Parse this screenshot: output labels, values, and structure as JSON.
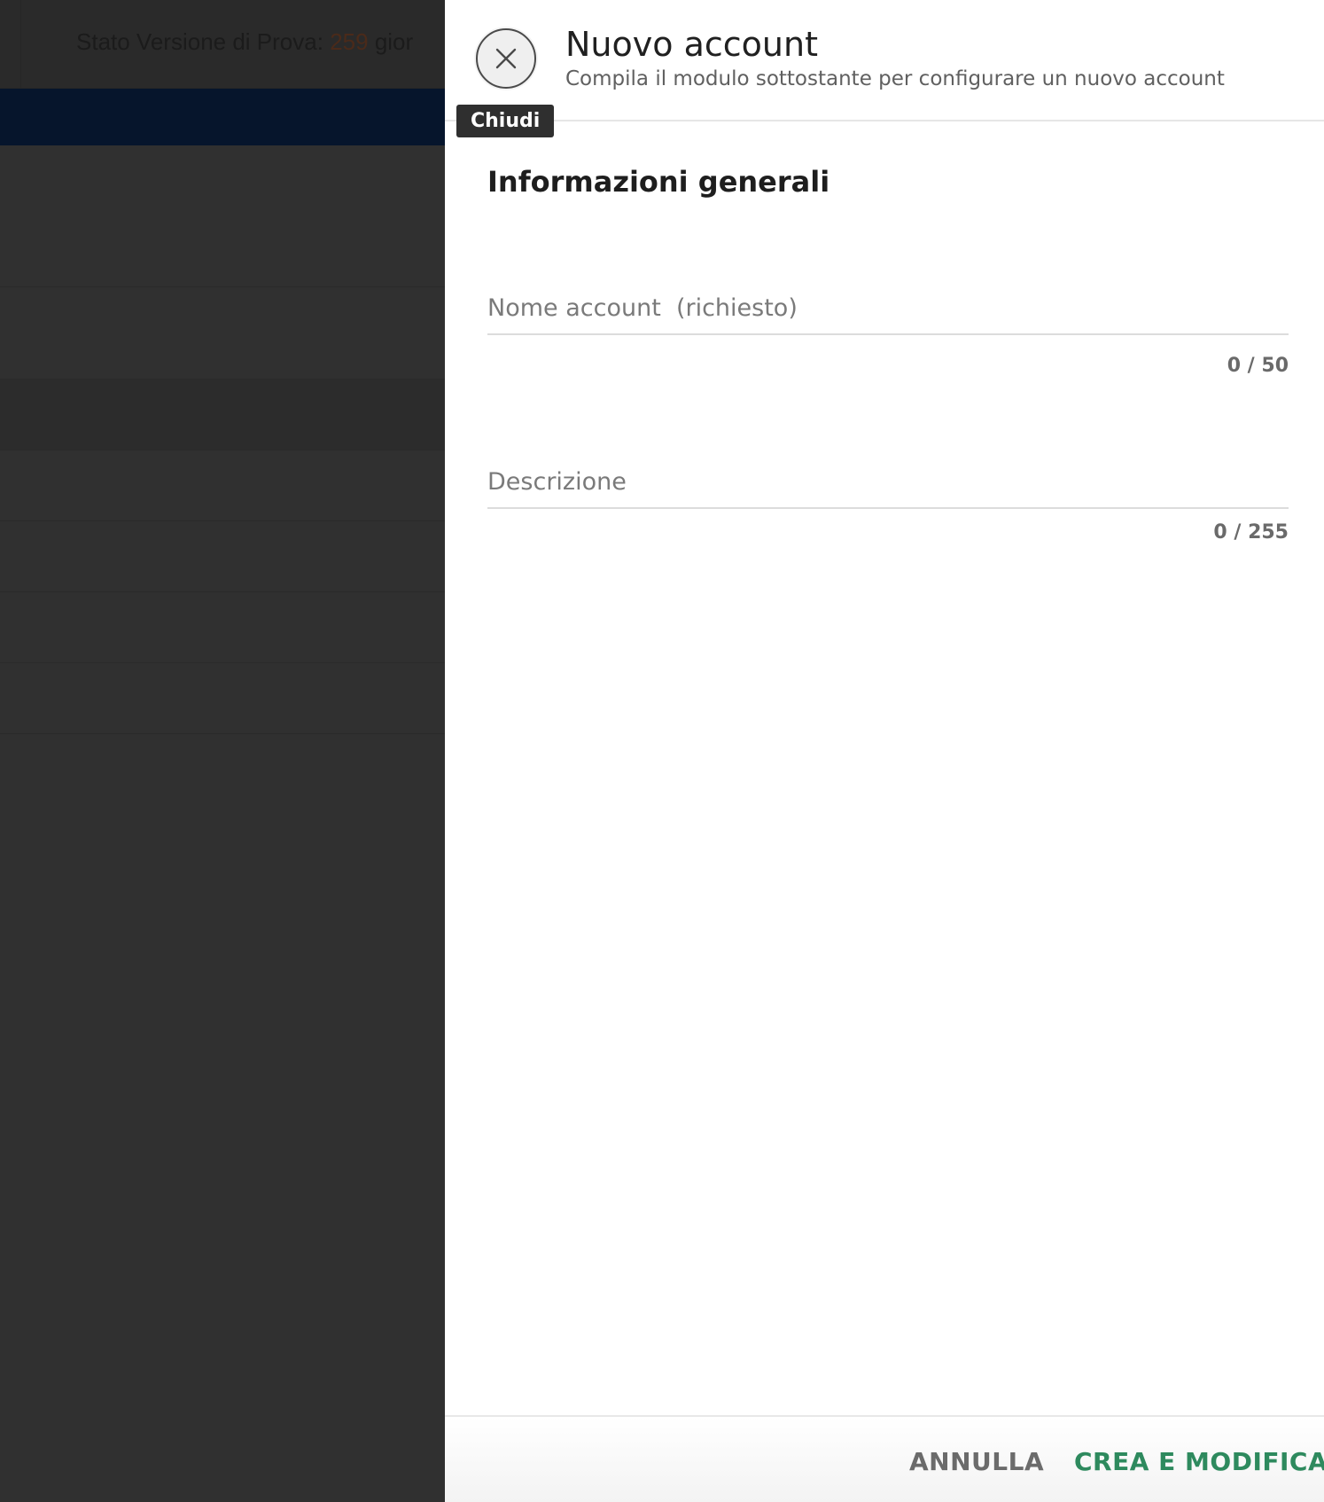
{
  "background": {
    "trial_status_label": "Stato Versione di Prova:",
    "trial_days": "259",
    "trial_suffix": "gior"
  },
  "drawer": {
    "close_tooltip": "Chiudi",
    "title": "Nuovo account",
    "subtitle": "Compila il modulo sottostante per configurare un nuovo account",
    "section_title": "Informazioni generali",
    "fields": {
      "account_name": {
        "placeholder": "Nome account  (richiesto)",
        "value": "",
        "counter": "0 / 50"
      },
      "description": {
        "placeholder": "Descrizione",
        "value": "",
        "counter": "0 / 255"
      }
    },
    "footer": {
      "cancel_label": "ANNULLA",
      "create_label": "CREA E MODIFICA"
    }
  },
  "colors": {
    "accent_green": "#2e8a5e",
    "navbar": "#06152c",
    "overlay_dark": "#303030"
  },
  "icons": {
    "close": "close-icon"
  }
}
